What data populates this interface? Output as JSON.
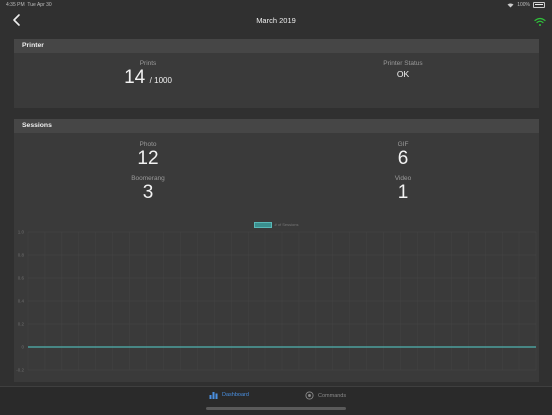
{
  "status_bar": {
    "time": "4:35 PM",
    "date": "Tue Apr 30",
    "battery": "100%"
  },
  "nav": {
    "title": "March 2019"
  },
  "printer": {
    "header": "Printer",
    "prints_label": "Prints",
    "prints_value": "14",
    "prints_total": "/ 1000",
    "status_label": "Printer Status",
    "status_value": "OK"
  },
  "sessions": {
    "header": "Sessions",
    "photo_label": "Photo",
    "photo_value": "12",
    "gif_label": "GIF",
    "gif_value": "6",
    "boomerang_label": "Boomerang",
    "boomerang_value": "3",
    "video_label": "Video",
    "video_value": "1"
  },
  "chart_data": {
    "type": "line",
    "series": [
      {
        "name": "# of Sessions",
        "values": [
          0,
          0,
          0,
          0,
          0,
          0,
          0,
          0,
          0,
          0,
          0,
          0,
          0,
          0,
          0,
          0,
          0,
          0,
          0,
          0,
          0,
          0,
          0,
          0,
          0,
          0,
          0,
          0,
          0,
          0,
          0
        ]
      }
    ],
    "y_ticks": [
      "1.0",
      "0.8",
      "0.6",
      "0.4",
      "0.2",
      "0",
      "-0.2"
    ],
    "ylim": [
      -0.2,
      1.0
    ],
    "legend": "# of Sessions",
    "line_color": "#4fb3b1",
    "grid": true,
    "legend_position": "top"
  },
  "tabs": {
    "dashboard": "Dashboard",
    "commands": "Commands",
    "active_color": "#4a90e2"
  }
}
